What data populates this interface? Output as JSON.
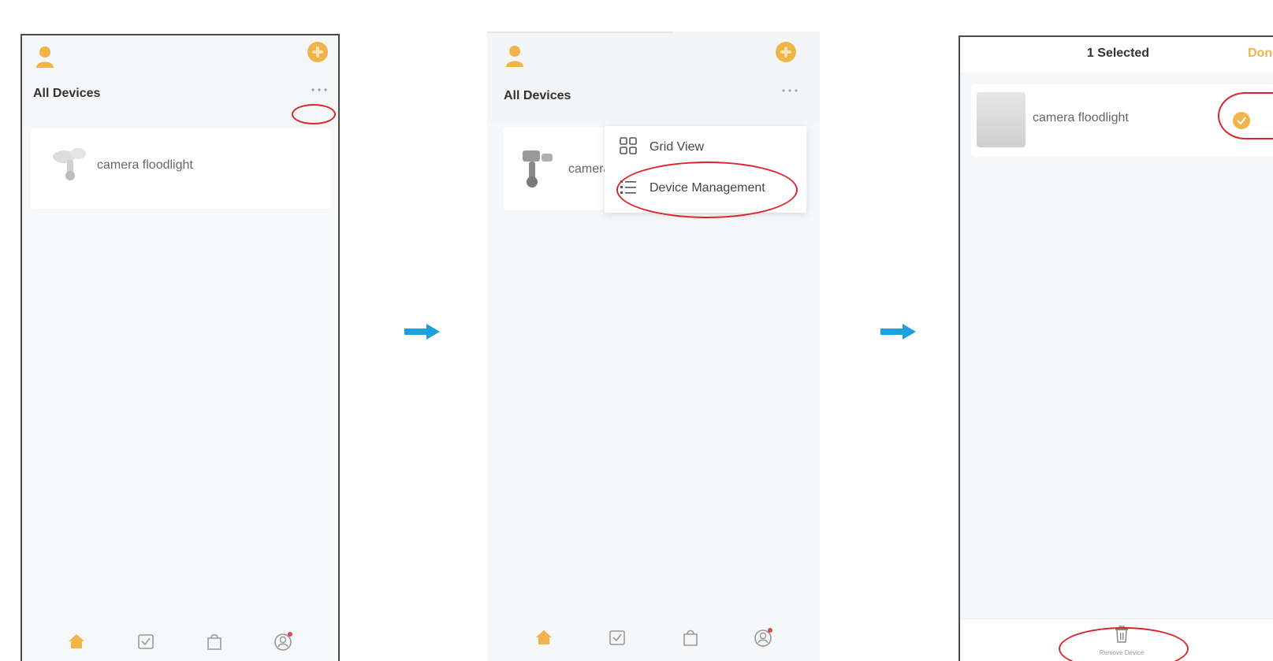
{
  "screens": {
    "screen1": {
      "title": "All Devices",
      "more_label": "···",
      "device_name": "camera floodlight",
      "tabs": [
        "home-icon",
        "scene-icon",
        "shop-icon",
        "profile-icon"
      ]
    },
    "screen2": {
      "title": "All Devices",
      "more_label": "···",
      "device_name": "camera floodlight",
      "menu": [
        {
          "label": "Grid View",
          "icon": "grid-icon"
        },
        {
          "label": "Device Management",
          "icon": "list-icon"
        }
      ],
      "tabs": [
        "home-icon",
        "scene-icon",
        "shop-icon",
        "profile-icon"
      ]
    },
    "screen3": {
      "selected_label": "1 Selected",
      "done_label": "Done",
      "device_name": "camera floodlight",
      "remove_label": "Remove Device"
    }
  },
  "colors": {
    "accent": "#f0b44a",
    "annotation": "#d9262c",
    "arrow": "#1ba1dd",
    "frame": "#4a4a4a"
  }
}
